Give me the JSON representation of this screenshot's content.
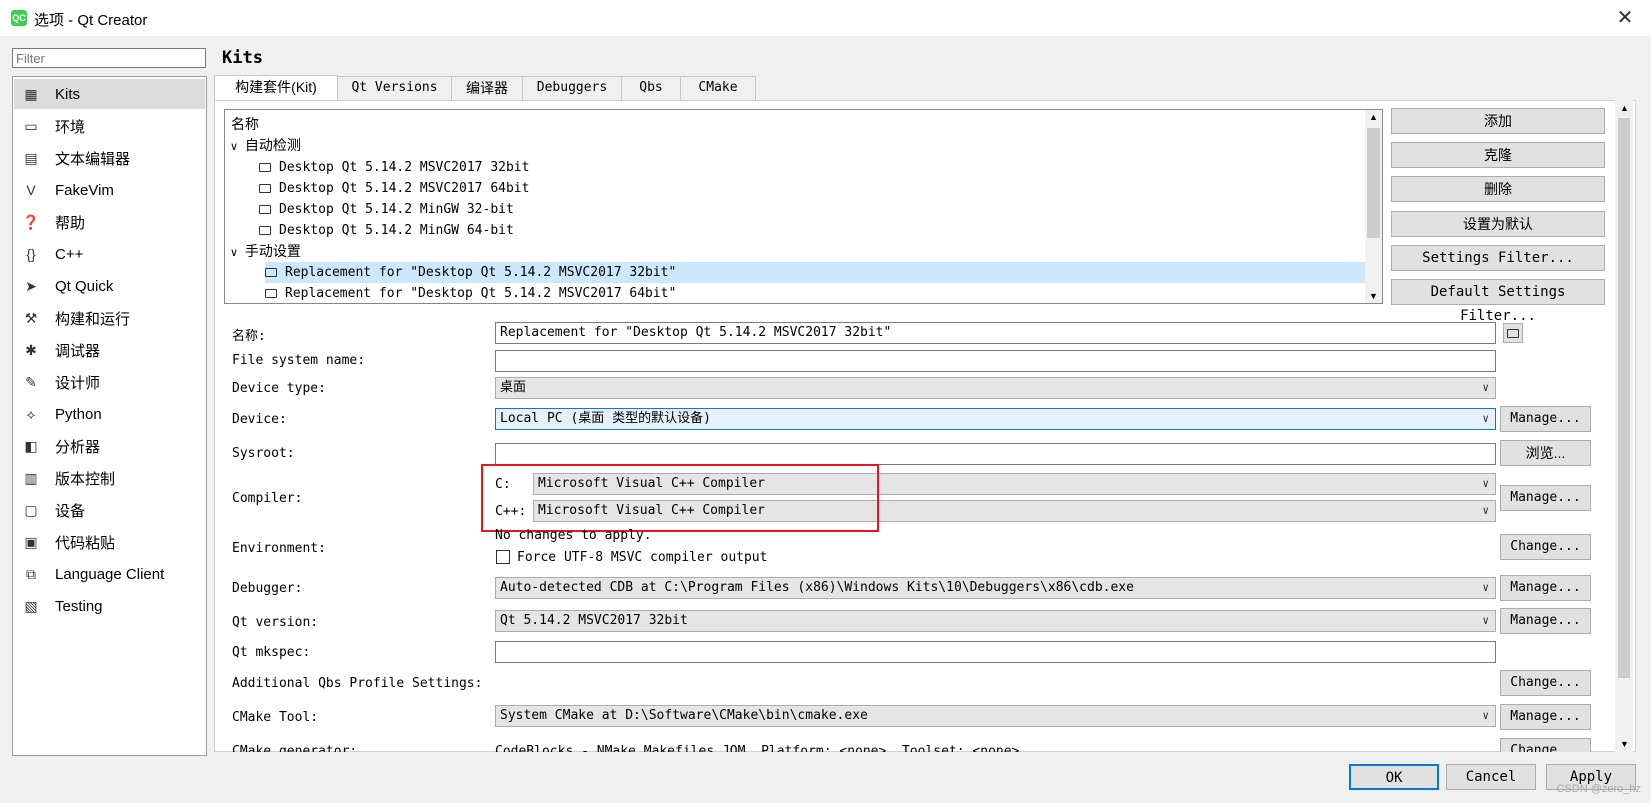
{
  "window": {
    "title": "选项 - Qt Creator",
    "icon": "QC",
    "close": "✕"
  },
  "filter": {
    "placeholder": "Filter"
  },
  "sidebar": {
    "items": [
      {
        "label": "Kits",
        "icon": "kits-icon"
      },
      {
        "label": "环境",
        "icon": "monitor-icon"
      },
      {
        "label": "文本编辑器",
        "icon": "text-editor-icon"
      },
      {
        "label": "FakeVim",
        "icon": "fakevim-icon"
      },
      {
        "label": "帮助",
        "icon": "help-icon"
      },
      {
        "label": "C++",
        "icon": "braces-icon"
      },
      {
        "label": "Qt Quick",
        "icon": "qt-quick-icon"
      },
      {
        "label": "构建和运行",
        "icon": "hammer-icon"
      },
      {
        "label": "调试器",
        "icon": "bug-icon"
      },
      {
        "label": "设计师",
        "icon": "pencil-icon"
      },
      {
        "label": "Python",
        "icon": "python-icon"
      },
      {
        "label": "分析器",
        "icon": "analyzer-icon"
      },
      {
        "label": "版本控制",
        "icon": "version-control-icon"
      },
      {
        "label": "设备",
        "icon": "device-icon"
      },
      {
        "label": "代码粘贴",
        "icon": "clipboard-icon"
      },
      {
        "label": "Language Client",
        "icon": "language-client-icon"
      },
      {
        "label": "Testing",
        "icon": "testing-icon"
      }
    ]
  },
  "page": {
    "heading": "Kits"
  },
  "tabs": [
    {
      "label": "构建套件(Kit)"
    },
    {
      "label": "Qt Versions"
    },
    {
      "label": "编译器"
    },
    {
      "label": "Debuggers"
    },
    {
      "label": "Qbs"
    },
    {
      "label": "CMake"
    }
  ],
  "tree": {
    "header": "名称",
    "auto_group": "自动检测",
    "auto_items": [
      "Desktop Qt 5.14.2 MSVC2017 32bit",
      "Desktop Qt 5.14.2 MSVC2017 64bit",
      "Desktop Qt 5.14.2 MinGW 32-bit",
      "Desktop Qt 5.14.2 MinGW 64-bit"
    ],
    "manual_group": "手动设置",
    "manual_items": [
      "Replacement for \"Desktop Qt 5.14.2 MSVC2017 32bit\"",
      "Replacement for \"Desktop Qt 5.14.2 MSVC2017 64bit\""
    ]
  },
  "side_buttons": [
    "添加",
    "克隆",
    "删除",
    "设置为默认",
    "Settings Filter...",
    "Default Settings Filter..."
  ],
  "form": {
    "name_label": "名称:",
    "name_value": "Replacement for \"Desktop Qt 5.14.2 MSVC2017 32bit\"",
    "fsname_label": "File system name:",
    "fsname_value": "",
    "devtype_label": "Device type:",
    "devtype_value": "桌面",
    "device_label": "Device:",
    "device_value": "Local PC (桌面 类型的默认设备)",
    "sysroot_label": "Sysroot:",
    "sysroot_value": "",
    "compiler_label": "Compiler:",
    "compiler_c_label": "C:",
    "compiler_c_value": "Microsoft Visual C++ Compiler",
    "compiler_cpp_label": "C++:",
    "compiler_cpp_value": "Microsoft Visual C++ Compiler",
    "env_label": "Environment:",
    "env_value": "No changes to apply.",
    "utf8_label": "Force UTF-8 MSVC compiler output",
    "utf8_checked": false,
    "debugger_label": "Debugger:",
    "debugger_value": "Auto-detected CDB at C:\\Program Files (x86)\\Windows Kits\\10\\Debuggers\\x86\\cdb.exe",
    "qtver_label": "Qt version:",
    "qtver_value": "Qt 5.14.2 MSVC2017 32bit",
    "mkspec_label": "Qt mkspec:",
    "mkspec_value": "",
    "qbs_label": "Additional Qbs Profile Settings:",
    "cmake_label": "CMake Tool:",
    "cmake_value": "System CMake at D:\\Software\\CMake\\bin\\cmake.exe",
    "cmakegen_label": "CMake generator:",
    "cmakegen_value": "CodeBlocks - NMake Makefiles JOM, Platform: <none>, Toolset: <none>"
  },
  "buttons": {
    "manage": "Manage...",
    "browse": "浏览...",
    "change": "Change..."
  },
  "dialog_buttons": {
    "ok": "OK",
    "cancel": "Cancel",
    "apply": "Apply"
  },
  "watermark": "CSDN @zero_hz",
  "colors": {
    "selection": "#cce8ff",
    "highlight_box": "#e0191c",
    "accent": "#0078d7"
  }
}
